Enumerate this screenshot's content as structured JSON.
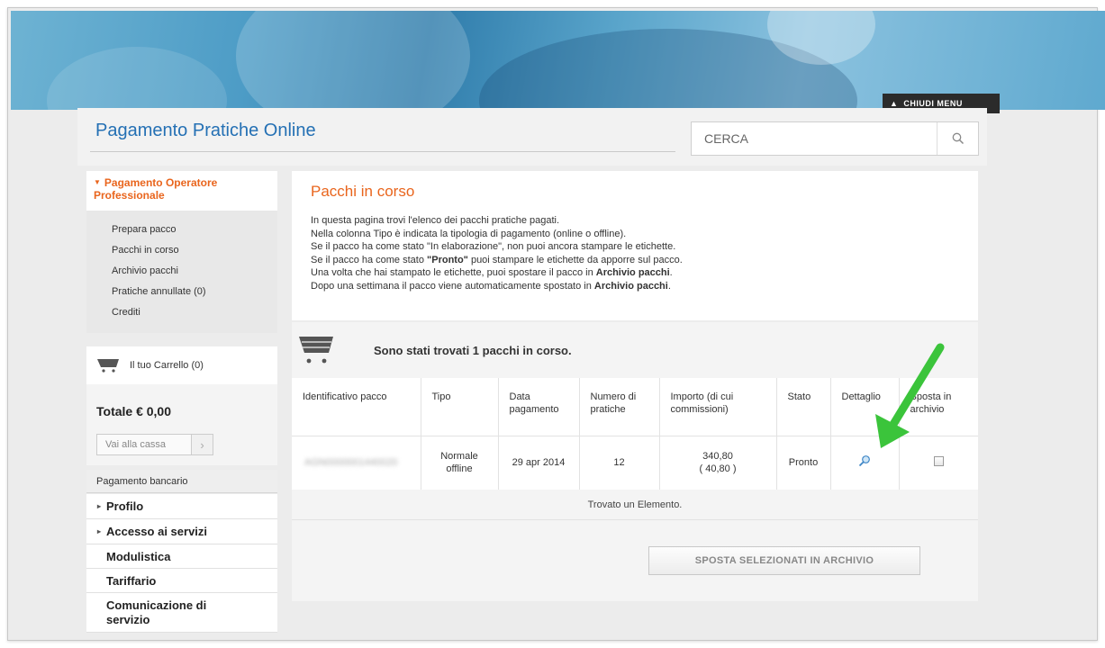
{
  "header": {
    "title": "Pagamento Pratiche Online",
    "close_menu": "CHIUDI MENU",
    "search_placeholder": "CERCA"
  },
  "sidebar": {
    "active_section": "Pagamento Operatore Professionale",
    "sub_items": [
      {
        "label": "Prepara pacco"
      },
      {
        "label": "Pacchi in corso"
      },
      {
        "label": "Archivio pacchi"
      },
      {
        "label": "Pratiche annullate (0)"
      },
      {
        "label": "Crediti"
      }
    ],
    "cart": {
      "label": "Il tuo Carrello (0)",
      "total": "Totale € 0,00",
      "checkout": "Vai alla cassa"
    },
    "bank_payment": "Pagamento bancario",
    "menu": [
      {
        "label": "Profilo"
      },
      {
        "label": "Accesso ai servizi"
      },
      {
        "label": "Modulistica"
      },
      {
        "label": "Tariffario"
      },
      {
        "label": "Comunicazione di servizio"
      }
    ]
  },
  "main": {
    "heading": "Pacchi in corso",
    "intro": {
      "line1": "In questa pagina trovi l'elenco dei pacchi pratiche pagati.",
      "line2": "Nella colonna Tipo è indicata la tipologia di pagamento (online o offline).",
      "line3": "Se il pacco ha come stato \"In elaborazione\", non puoi ancora stampare le etichette.",
      "line4_a": "Se il pacco ha come stato ",
      "line4_b": "\"Pronto\"",
      "line4_c": " puoi stampare le etichette da apporre sul pacco.",
      "line5_a": "Una volta che hai stampato le etichette, puoi spostare il pacco in ",
      "line5_b": "Archivio pacchi",
      "line5_c": ".",
      "line6_a": "Dopo una settimana il pacco viene automaticamente spostato in ",
      "line6_b": "Archivio pacchi",
      "line6_c": "."
    },
    "results_text": "Sono stati trovati 1 pacchi in corso.",
    "table": {
      "headers": {
        "id": "Identificativo pacco",
        "tipo": "Tipo",
        "data": "Data pagamento",
        "numero": "Numero di pratiche",
        "importo": "Importo (di cui commissioni)",
        "stato": "Stato",
        "dettaglio": "Dettaglio",
        "sposta": "Sposta in archivio"
      },
      "row": {
        "id": "AGN0000001440020",
        "tipo": "Normale offline",
        "data": "29 apr 2014",
        "numero": "12",
        "importo": "340,80",
        "commissioni": "( 40,80 )",
        "stato": "Pronto"
      }
    },
    "found_text": "Trovato un Elemento.",
    "archive_button": "SPOSTA SELEZIONATI IN ARCHIVIO"
  },
  "colors": {
    "accent_orange": "#e9651d",
    "title_blue": "#2470b4",
    "annotation_arrow": "#3bc43b"
  }
}
